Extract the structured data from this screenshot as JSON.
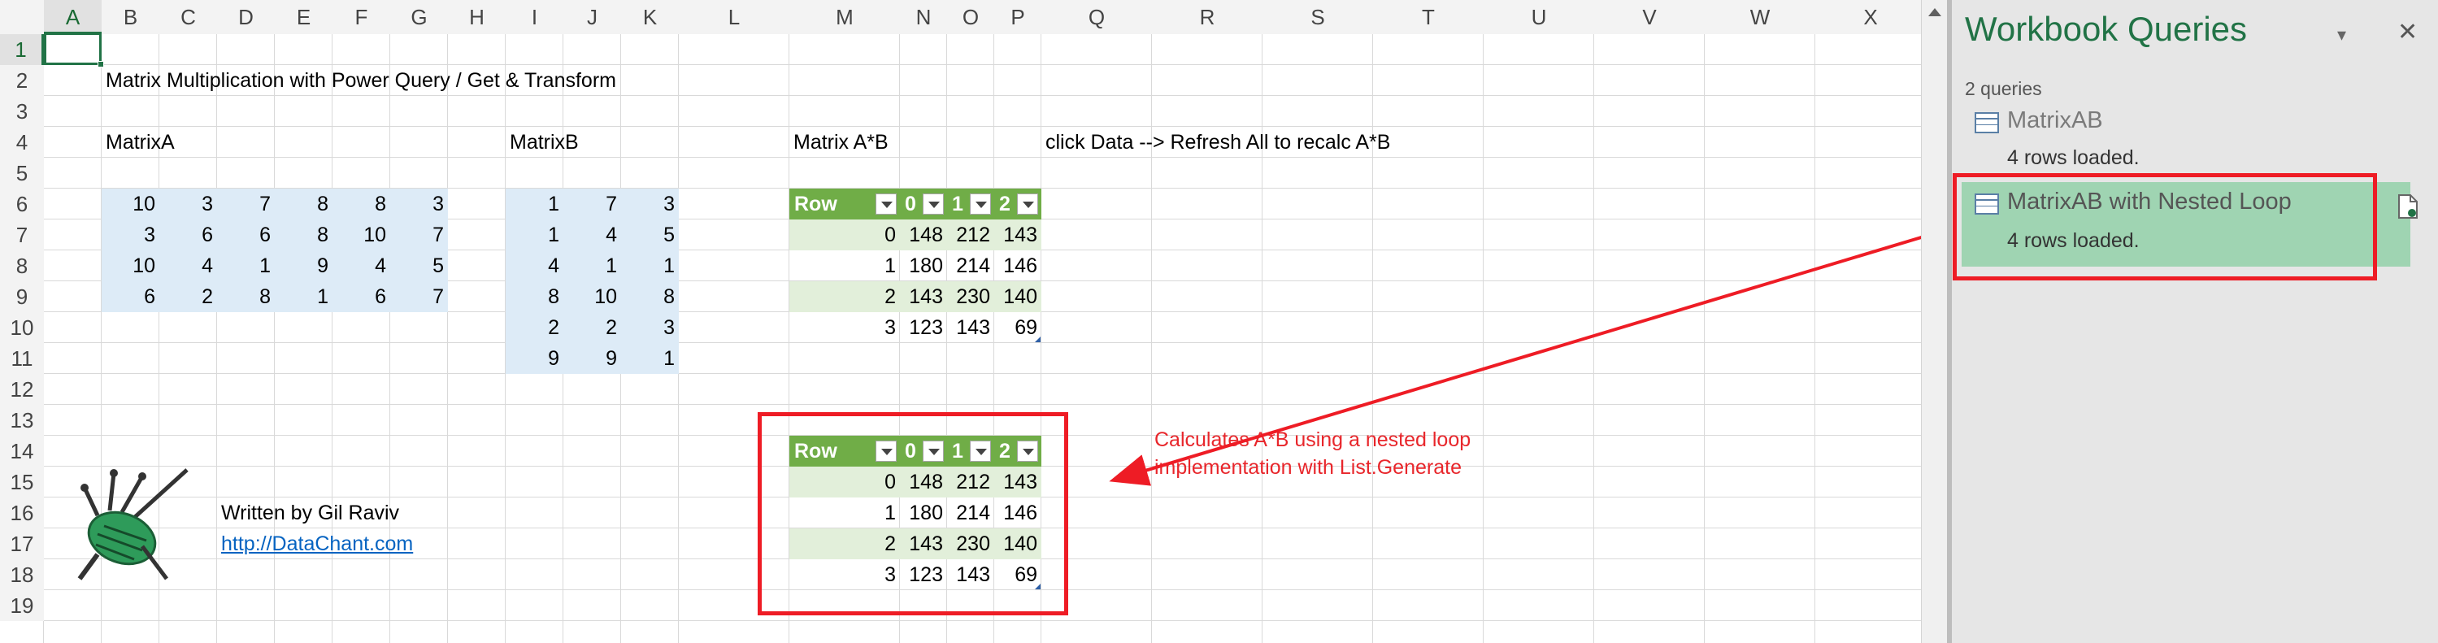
{
  "columns": [
    "A",
    "B",
    "C",
    "D",
    "E",
    "F",
    "G",
    "H",
    "I",
    "J",
    "K",
    "L",
    "M",
    "N",
    "O",
    "P",
    "Q",
    "R",
    "S",
    "T",
    "U",
    "V",
    "W",
    "X"
  ],
  "rows": [
    "1",
    "2",
    "3",
    "4",
    "5",
    "6",
    "7",
    "8",
    "9",
    "10",
    "11",
    "12",
    "13",
    "14",
    "15",
    "16",
    "17",
    "18",
    "19"
  ],
  "sheet": {
    "title": "Matrix Multiplication with Power Query / Get & Transform",
    "matrix_a_label": "MatrixA",
    "matrix_b_label": "MatrixB",
    "matrix_ab_label": "Matrix A*B",
    "refresh_note": "click Data --> Refresh All to recalc A*B",
    "matrix_a": [
      [
        "10",
        "3",
        "7",
        "8",
        "8",
        "3"
      ],
      [
        "3",
        "6",
        "6",
        "8",
        "10",
        "7"
      ],
      [
        "10",
        "4",
        "1",
        "9",
        "4",
        "5"
      ],
      [
        "6",
        "2",
        "8",
        "1",
        "6",
        "7"
      ]
    ],
    "matrix_b": [
      [
        "1",
        "7",
        "3"
      ],
      [
        "1",
        "4",
        "5"
      ],
      [
        "4",
        "1",
        "1"
      ],
      [
        "8",
        "10",
        "8"
      ],
      [
        "2",
        "2",
        "3"
      ],
      [
        "9",
        "9",
        "1"
      ]
    ],
    "table1": {
      "headers": [
        "Row",
        "0",
        "1",
        "2"
      ],
      "rows": [
        [
          "0",
          "148",
          "212",
          "143"
        ],
        [
          "1",
          "180",
          "214",
          "146"
        ],
        [
          "2",
          "143",
          "230",
          "140"
        ],
        [
          "3",
          "123",
          "143",
          "69"
        ]
      ]
    },
    "table2": {
      "headers": [
        "Row",
        "0",
        "1",
        "2"
      ],
      "rows": [
        [
          "0",
          "148",
          "212",
          "143"
        ],
        [
          "1",
          "180",
          "214",
          "146"
        ],
        [
          "2",
          "143",
          "230",
          "140"
        ],
        [
          "3",
          "123",
          "143",
          "69"
        ]
      ]
    },
    "annotation_line1": "Calculates A*B using a nested loop",
    "annotation_line2": "implementation with List.Generate",
    "author": "Written by Gil Raviv",
    "link": "http://DataChant.com"
  },
  "pane": {
    "title": "Workbook Queries",
    "count": "2 queries",
    "queries": [
      {
        "name": "MatrixAB",
        "status": "4 rows loaded."
      },
      {
        "name": "MatrixAB with Nested Loop",
        "status": "4 rows loaded."
      }
    ]
  },
  "colors": {
    "accent": "#217346",
    "table_header": "#70ad47",
    "table_band": "#e2efda",
    "input_fill": "#ddebf7",
    "highlight": "#ee1c25",
    "selected_query": "#9fd4b2"
  }
}
